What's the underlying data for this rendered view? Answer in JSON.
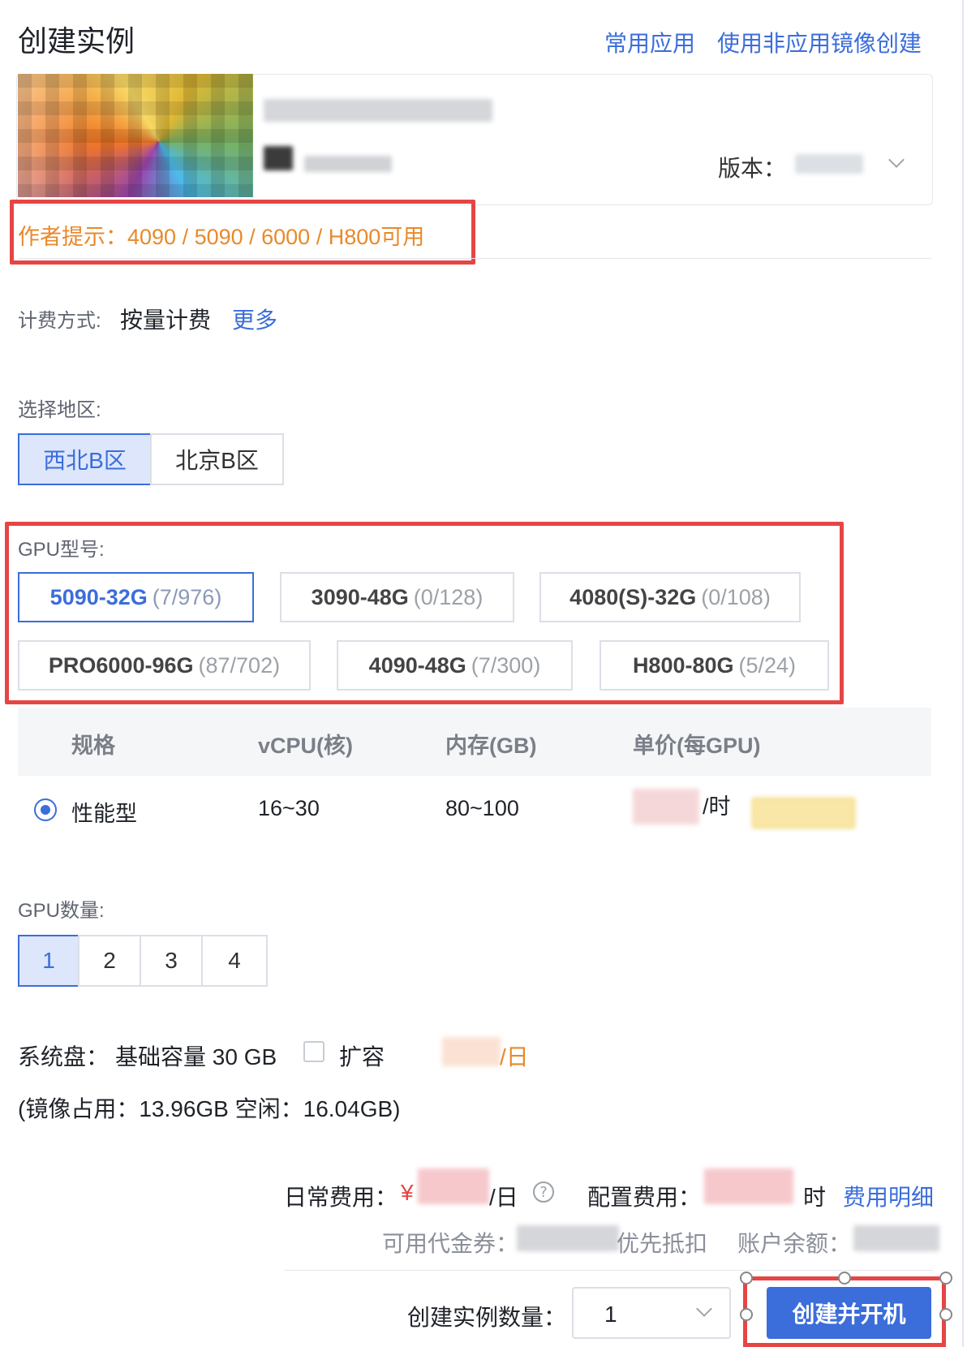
{
  "header": {
    "title": "创建实例",
    "common_apps": "常用应用",
    "create_non_app": "使用非应用镜像创建"
  },
  "app": {
    "version_label": "版本："
  },
  "tip": "作者提示：4090 / 5090 / 6000 / H800可用",
  "billing": {
    "label": "计费方式:",
    "value": "按量计费",
    "more": "更多"
  },
  "region": {
    "label": "选择地区:",
    "options": [
      "西北B区",
      "北京B区"
    ],
    "selected": "西北B区"
  },
  "gpu": {
    "label": "GPU型号:",
    "options": [
      {
        "name": "5090-32G",
        "avail": "(7/976)",
        "selected": true
      },
      {
        "name": "3090-48G",
        "avail": "(0/128)",
        "selected": false
      },
      {
        "name": "4080(S)-32G",
        "avail": "(0/108)",
        "selected": false
      },
      {
        "name": "PRO6000-96G",
        "avail": "(87/702)",
        "selected": false
      },
      {
        "name": "4090-48G",
        "avail": "(7/300)",
        "selected": false
      },
      {
        "name": "H800-80G",
        "avail": "(5/24)",
        "selected": false
      }
    ]
  },
  "spec": {
    "headers": [
      "规格",
      "vCPU(核)",
      "内存(GB)",
      "单价(每GPU)"
    ],
    "row": {
      "type": "性能型",
      "vcpu": "16~30",
      "memory": "80~100",
      "price_unit": "/时"
    }
  },
  "gpu_count": {
    "label": "GPU数量:",
    "options": [
      "1",
      "2",
      "3",
      "4"
    ],
    "selected": "1"
  },
  "disk": {
    "label": "系统盘：",
    "base": "基础容量 30 GB",
    "expand": "扩容",
    "per_day": "/日",
    "usage": "(镜像占用：13.96GB   空闲：16.04GB)"
  },
  "footer": {
    "daily_label": "日常费用：",
    "currency": "¥",
    "per_day": "/日",
    "help": "?",
    "config_label": "配置费用：",
    "per_hour": "时",
    "fee_detail": "费用明细",
    "voucher_label": "可用代金券：",
    "priority": "优先抵扣",
    "balance_label": "账户余额：",
    "count_label": "创建实例数量：",
    "count_value": "1",
    "create_button": "创建并开机"
  },
  "colors": {
    "primary": "#3b6ddb",
    "tip": "#e8892b",
    "highlight": "#e64545",
    "active_bg": "#dde6fb"
  }
}
